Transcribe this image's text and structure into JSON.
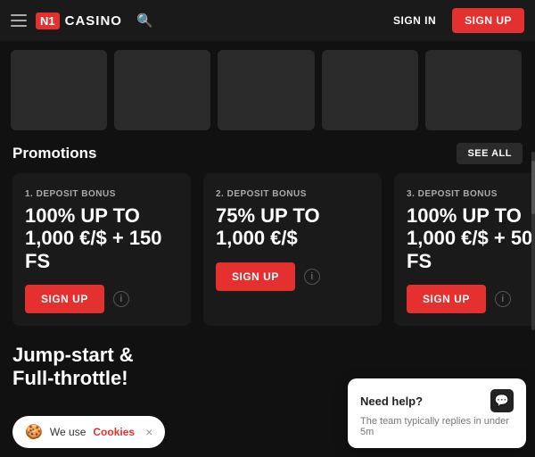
{
  "header": {
    "logo_n1": "N1",
    "logo_casino": "CASINO",
    "signin_label": "SIGN IN",
    "signup_label": "SIGN UP"
  },
  "promotions": {
    "title": "Promotions",
    "see_all_label": "SEE ALL",
    "cards": [
      {
        "deposit_label": "1. DEPOSIT BONUS",
        "amount": "100% UP TO\n1,000 €/$ + 150 FS",
        "signup_label": "SIGN UP"
      },
      {
        "deposit_label": "2. DEPOSIT BONUS",
        "amount": "75% UP TO\n1,000 €/$",
        "signup_label": "SIGN UP"
      },
      {
        "deposit_label": "3. DEPOSIT BONUS",
        "amount": "100% UP TO\n1,000 €/$ + 50 FS",
        "signup_label": "SIGN UP"
      }
    ]
  },
  "jumpstart": {
    "title": "Jump-start &\nFull-throttle!"
  },
  "cookie_bar": {
    "text": "We use ",
    "link_text": "Cookies",
    "close_symbol": "×"
  },
  "chat_widget": {
    "title": "Need help?",
    "subtitle": "The team typically replies in under 5m",
    "icon": "💬"
  }
}
